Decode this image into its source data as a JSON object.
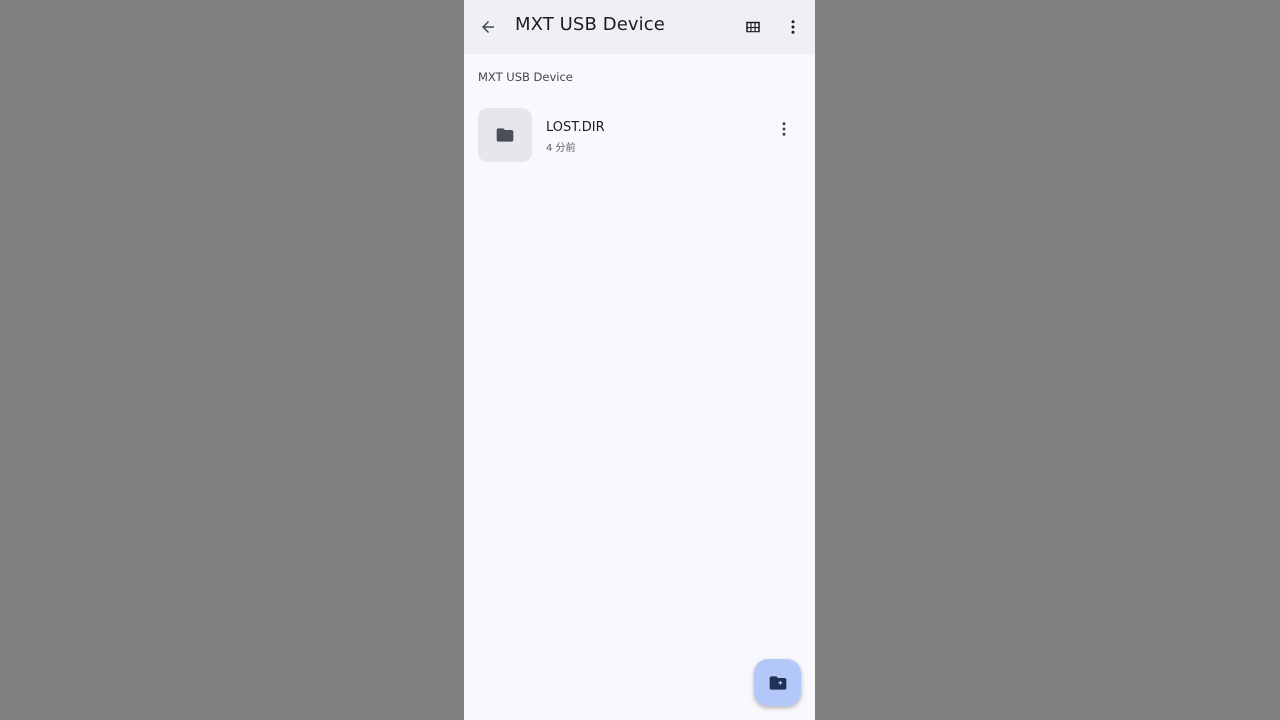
{
  "appbar": {
    "title": "MXT USB Device",
    "back_icon": "arrow-back-icon",
    "grid_icon": "grid-view-icon",
    "more_icon": "more-vert-icon"
  },
  "breadcrumb": {
    "label": "MXT USB Device"
  },
  "files": [
    {
      "name": "LOST.DIR",
      "meta": "4 分前",
      "icon": "folder-icon"
    }
  ],
  "fab": {
    "icon": "create-new-folder-icon"
  },
  "colors": {
    "appbar_bg": "#eff0f6",
    "page_bg": "#f9f9fd",
    "fab_bg": "#b3c8f9",
    "icon_dark": "#4a4e58"
  }
}
